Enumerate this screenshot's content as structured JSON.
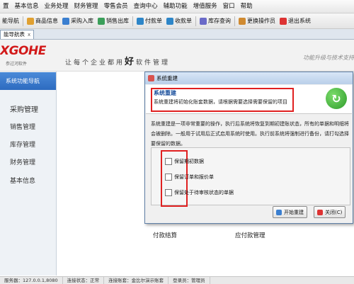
{
  "menubar": {
    "items": [
      "基本信息",
      "业务处理",
      "财务管理",
      "零售会员",
      "查询中心",
      "辅助功能",
      "增值服务",
      "窗口",
      "帮助"
    ],
    "leading": "置"
  },
  "toolbar": {
    "items": [
      {
        "label": "能导航 ",
        "icon": "nav-icon",
        "color": "#4a8ad8"
      },
      {
        "label": "商品信息",
        "icon": "goods-icon",
        "color": "#e0a030"
      },
      {
        "label": "采购入库",
        "icon": "purchase-icon",
        "color": "#3b7fd0"
      },
      {
        "label": "销售出库",
        "icon": "sales-icon",
        "color": "#3b9f5a"
      },
      {
        "label": "付款单",
        "icon": "payment-icon",
        "color": "#2e86c8"
      },
      {
        "label": "收款单",
        "icon": "receipt-icon",
        "color": "#2e86c8"
      },
      {
        "label": "库存查询",
        "icon": "stock-icon",
        "color": "#6a6ac8"
      },
      {
        "label": "更换操作员",
        "icon": "switch-user-icon",
        "color": "#d08a30"
      },
      {
        "label": "退出系统",
        "icon": "exit-icon",
        "color": "#d33"
      }
    ]
  },
  "tab": {
    "label": "能导航表",
    "close": "x"
  },
  "header": {
    "logo": "XGOHE",
    "logo_sub": "参过河软件",
    "slogan_pre": "让每个企业都用",
    "slogan_big": "好",
    "slogan_post": "软件管理",
    "right_slogan": "功能升级与技术支持"
  },
  "sidebar": {
    "title": "系统功能导航",
    "items": [
      "采购管理",
      "销售管理",
      "库存管理",
      "财务管理",
      "基本信息"
    ]
  },
  "main": {
    "label_left": "付款结算",
    "label_right": "应付款管理"
  },
  "dialog": {
    "title": "系统重建",
    "heading": "系统重建",
    "subheading": "系统重建将初始化账套数据，请根据需要选择需要保留的项目",
    "description": "系统重建是一项非常重要的操作，执行后系统将恢复到期初建账状态，所有的单据和明细将会被删除。一般用于试用后正式启用系统时使用。执行前系统将强制进行备份，请打勾选择要保留的数据。",
    "options": [
      {
        "label": "保留期初数据",
        "checked": false
      },
      {
        "label": "保留订单和报价单",
        "checked": false
      },
      {
        "label": "保留处于待审核状态的单据",
        "checked": false
      }
    ],
    "start_button": "开始重建",
    "close_button": "关闭(C)"
  },
  "statusbar": {
    "items": [
      "服务器：127.0.0.1,8080",
      "连接状态：正常",
      "连接账套：金比尔演示账套",
      "登录员：管理员"
    ]
  }
}
